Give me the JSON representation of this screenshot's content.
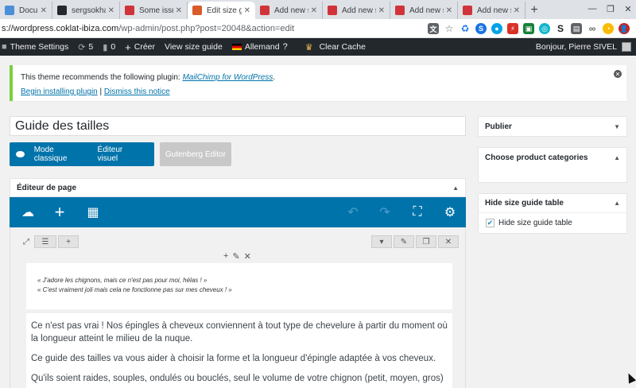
{
  "browser": {
    "tabs": [
      {
        "label": "Documents",
        "color": "#4a90d9",
        "active": false
      },
      {
        "label": "sergsokhar",
        "color": "#24292e",
        "active": false
      },
      {
        "label": "Some issue",
        "color": "#d0343a",
        "active": false
      },
      {
        "label": "Edit size gu",
        "color": "#d85b2a",
        "active": true
      },
      {
        "label": "Add new si",
        "color": "#d0343a",
        "active": false
      },
      {
        "label": "Add new si",
        "color": "#d0343a",
        "active": false
      },
      {
        "label": "Add new si",
        "color": "#d0343a",
        "active": false
      },
      {
        "label": "Add new si",
        "color": "#d0343a",
        "active": false
      }
    ],
    "new_tab": "+",
    "url_host": "s://wordpress.coklat-ibiza.com",
    "url_path": "/wp-admin/post.php?post=20048&action=edit"
  },
  "adminbar": {
    "theme_settings": "Theme Settings",
    "updates_count": "5",
    "comments_count": "0",
    "create": "Créer",
    "view_size_guide": "View size guide",
    "language": "Allemand",
    "clear_cache": "Clear Cache",
    "greeting": "Bonjour, Pierre SIVEL"
  },
  "notice": {
    "text_before": "This theme recommends the following plugin: ",
    "plugin_link": "MailChimp for WordPress",
    "text_after": ".",
    "install_link": "Begin installing plugin",
    "separator": " | ",
    "dismiss_link": "Dismiss this notice"
  },
  "title": {
    "value": "Guide des tailles"
  },
  "modes": {
    "classic": "Mode classique",
    "visual": "Éditeur visuel",
    "gutenberg": "Gutenberg Editor"
  },
  "page_editor": {
    "label": "Éditeur de page"
  },
  "content": {
    "quote_line1": "« J'adore les chignons, mais ce n'est pas pour moi, hélas ! »",
    "quote_line2": "« C'est vraiment joli mais cela ne fonctionne pas sur mes cheveux ! »",
    "para1": "Ce n'est pas vrai ! Nos épingles à cheveux conviennent à tout type de chevelure à partir du moment où la longueur atteint le milieu de la nuque.",
    "para2": "Ce guide des tailles va vous aider à choisir la forme et la longueur d'épingle adaptée à vos cheveux.",
    "para3": "Qu'ils soient raides, souples, ondulés ou bouclés, seul le volume de votre chignon (petit, moyen, gros)"
  },
  "sidebar": {
    "publish": "Publier",
    "categories": "Choose product categories",
    "hide_table_title": "Hide size guide table",
    "hide_table_checkbox": "Hide size guide table"
  }
}
